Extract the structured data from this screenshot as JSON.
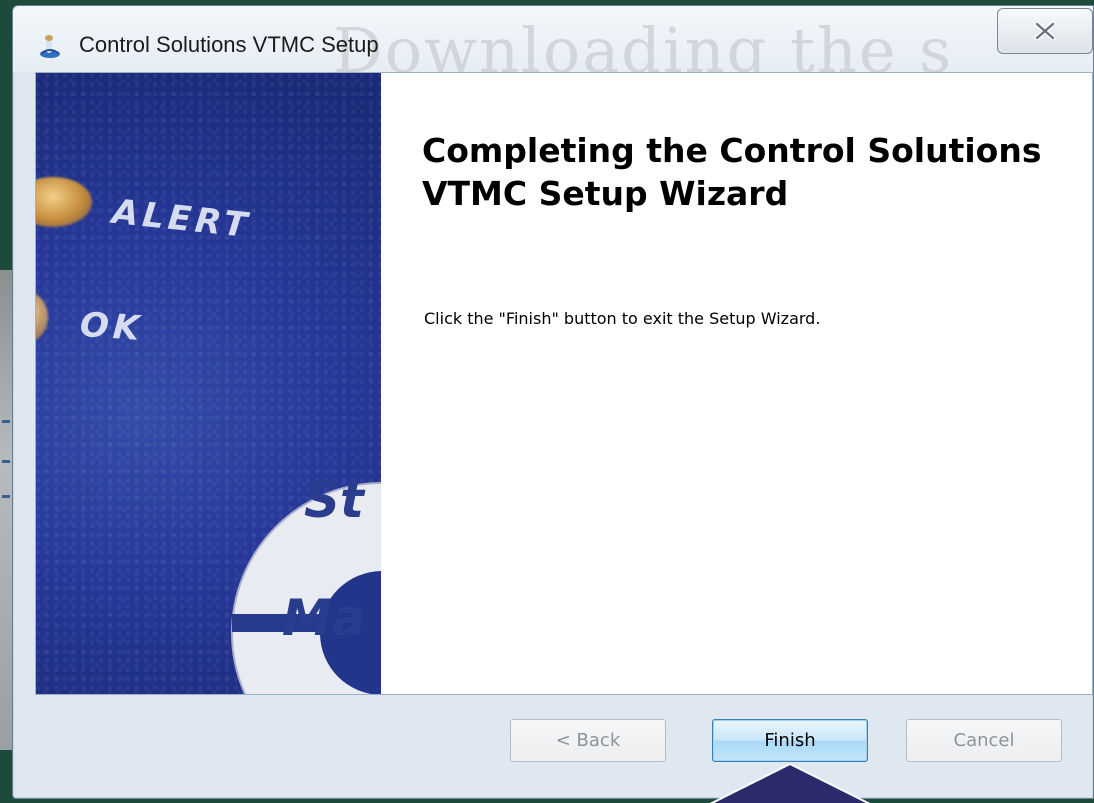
{
  "window": {
    "title": "Control Solutions VTMC Setup",
    "background_watermark": "Downloading the s"
  },
  "banner": {
    "labels": [
      "ALERT",
      "OK"
    ],
    "dial_text": [
      "St",
      "Ma"
    ]
  },
  "content": {
    "heading": "Completing the Control Solutions VTMC Setup Wizard",
    "instructions": "Click the \"Finish\" button to exit the Setup Wizard."
  },
  "buttons": {
    "back": "< Back",
    "finish": "Finish",
    "cancel": "Cancel"
  },
  "colors": {
    "banner_blue": "#27389a",
    "finish_highlight": "#a7d8f7",
    "arrow_purple": "#2b2a6b",
    "frame_green": "#1d4b3b"
  },
  "icons": {
    "app": "installer-icon",
    "close": "close-icon",
    "pointer": "arrow-up-icon"
  }
}
